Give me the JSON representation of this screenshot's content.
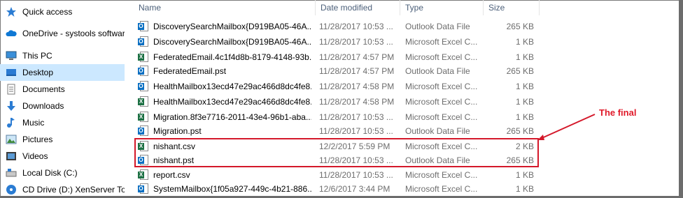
{
  "nav": {
    "items": [
      {
        "label": "Quick access",
        "icon": "star-icon"
      },
      {
        "label": "OneDrive - systools software",
        "icon": "cloud-icon"
      },
      {
        "label": "This PC",
        "icon": "computer-icon"
      },
      {
        "label": "Desktop",
        "icon": "desktop-icon"
      },
      {
        "label": "Documents",
        "icon": "documents-icon"
      },
      {
        "label": "Downloads",
        "icon": "downloads-icon"
      },
      {
        "label": "Music",
        "icon": "music-icon"
      },
      {
        "label": "Pictures",
        "icon": "pictures-icon"
      },
      {
        "label": "Videos",
        "icon": "videos-icon"
      },
      {
        "label": "Local Disk (C:)",
        "icon": "disk-icon"
      },
      {
        "label": "CD Drive (D:) XenServer Too",
        "icon": "cd-drive-icon"
      }
    ]
  },
  "columns": {
    "name": "Name",
    "date": "Date modified",
    "type": "Type",
    "size": "Size"
  },
  "files": [
    {
      "name": "DiscoverySearchMailbox{D919BA05-46A...",
      "date": "11/28/2017 10:53 ...",
      "type": "Outlook Data File",
      "size": "265 KB",
      "kind": "outlook"
    },
    {
      "name": "DiscoverySearchMailbox{D919BA05-46A...",
      "date": "11/28/2017 10:53 ...",
      "type": "Microsoft Excel C...",
      "size": "1 KB",
      "kind": "outlook"
    },
    {
      "name": "FederatedEmail.4c1f4d8b-8179-4148-93b...",
      "date": "11/28/2017 4:57 PM",
      "type": "Microsoft Excel C...",
      "size": "1 KB",
      "kind": "excel"
    },
    {
      "name": "FederatedEmail.pst",
      "date": "11/28/2017 4:57 PM",
      "type": "Outlook Data File",
      "size": "265 KB",
      "kind": "outlook"
    },
    {
      "name": "HealthMailbox13ecd47e29ac466d8dc4fe8...",
      "date": "11/28/2017 4:58 PM",
      "type": "Microsoft Excel C...",
      "size": "1 KB",
      "kind": "outlook"
    },
    {
      "name": "HealthMailbox13ecd47e29ac466d8dc4fe8...",
      "date": "11/28/2017 4:58 PM",
      "type": "Microsoft Excel C...",
      "size": "1 KB",
      "kind": "excel"
    },
    {
      "name": "Migration.8f3e7716-2011-43e4-96b1-aba...",
      "date": "11/28/2017 10:53 ...",
      "type": "Microsoft Excel C...",
      "size": "1 KB",
      "kind": "excel"
    },
    {
      "name": "Migration.pst",
      "date": "11/28/2017 10:53 ...",
      "type": "Outlook Data File",
      "size": "265 KB",
      "kind": "outlook"
    },
    {
      "name": "nishant.csv",
      "date": "12/2/2017 5:59 PM",
      "type": "Microsoft Excel C...",
      "size": "2 KB",
      "kind": "excel"
    },
    {
      "name": "nishant.pst",
      "date": "11/28/2017 10:53 ...",
      "type": "Outlook Data File",
      "size": "265 KB",
      "kind": "outlook"
    },
    {
      "name": "report.csv",
      "date": "11/28/2017 10:53 ...",
      "type": "Microsoft Excel C...",
      "size": "1 KB",
      "kind": "excel"
    },
    {
      "name": "SystemMailbox{1f05a927-449c-4b21-886...",
      "date": "12/6/2017 3:44 PM",
      "type": "Microsoft Excel C...",
      "size": "1 KB",
      "kind": "outlook"
    }
  ],
  "annotation": {
    "text": "The final",
    "color": "#e01a2a"
  },
  "colors": {
    "selected_nav": "#cce8ff",
    "highlight_box": "#d4182a",
    "outlook": "#0a6fc2",
    "excel": "#1e7145"
  }
}
